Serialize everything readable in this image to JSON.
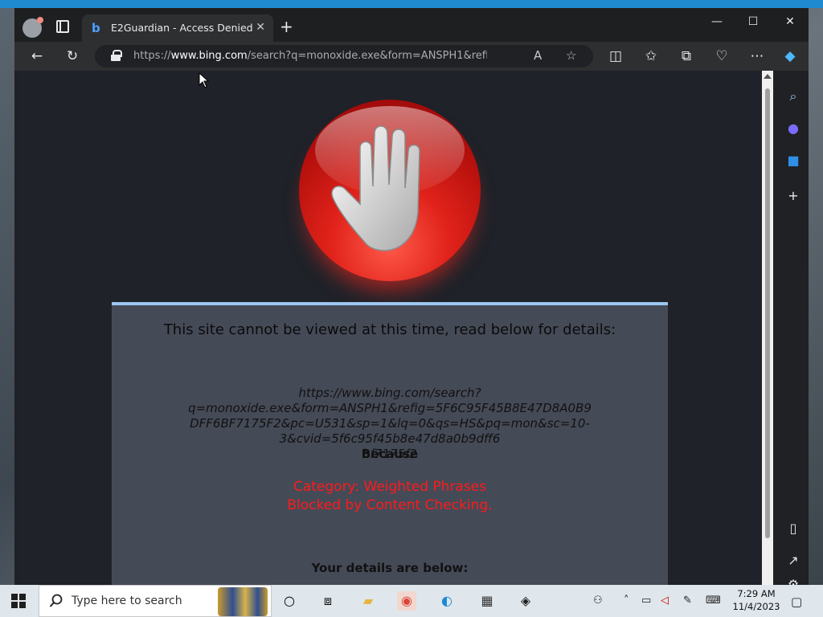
{
  "browser": {
    "tab_title": "E2Guardian - Access Denied",
    "tab_close": "✕",
    "new_tab": "+",
    "url_prefix": "https://",
    "url_domain": "www.bing.com",
    "url_rest": "/search?q=monoxide.exe&form=ANSPH1&refig=5F6C...",
    "window_controls": [
      "—",
      "☐",
      "✕"
    ]
  },
  "page": {
    "heading": "This site cannot be viewed at this time, read below for details:",
    "blocked_url_lines": [
      "https://www.bing.com/search?q=monoxide.exe&form=ANSPH1&refig=5F6C95F45B8E47D8A0B9",
      "DFF6BF7175F2&pc=U531&sp=1&lq=0&qs=HS&pq=mon&sc=10-3&cvid=5f6c95f45b8e47d8a0b9dff6",
      "bf7175f2"
    ],
    "because": "Because",
    "reason_lines": [
      "Category: Weighted Phrases",
      "Blocked by Content Checking."
    ],
    "details_heading": "Your details are below:"
  },
  "taskbar": {
    "search_placeholder": "Type here to search",
    "time": "7:29 AM",
    "date": "11/4/2023"
  },
  "colors": {
    "reason_text": "#ff1a1a",
    "panel_bg": "#454a57",
    "page_bg": "#1f2229",
    "panel_accent": "#9cc7f0"
  },
  "icons": {
    "back": "back-arrow-icon",
    "refresh": "refresh-icon",
    "lock": "lock-icon",
    "read_aloud": "read-aloud-icon",
    "favorite": "star-icon",
    "split_screen": "split-screen-icon",
    "favorites": "favorites-icon",
    "collections": "collections-icon",
    "performance": "heartbeat-icon",
    "more": "more-icon",
    "copilot": "copilot-icon"
  }
}
